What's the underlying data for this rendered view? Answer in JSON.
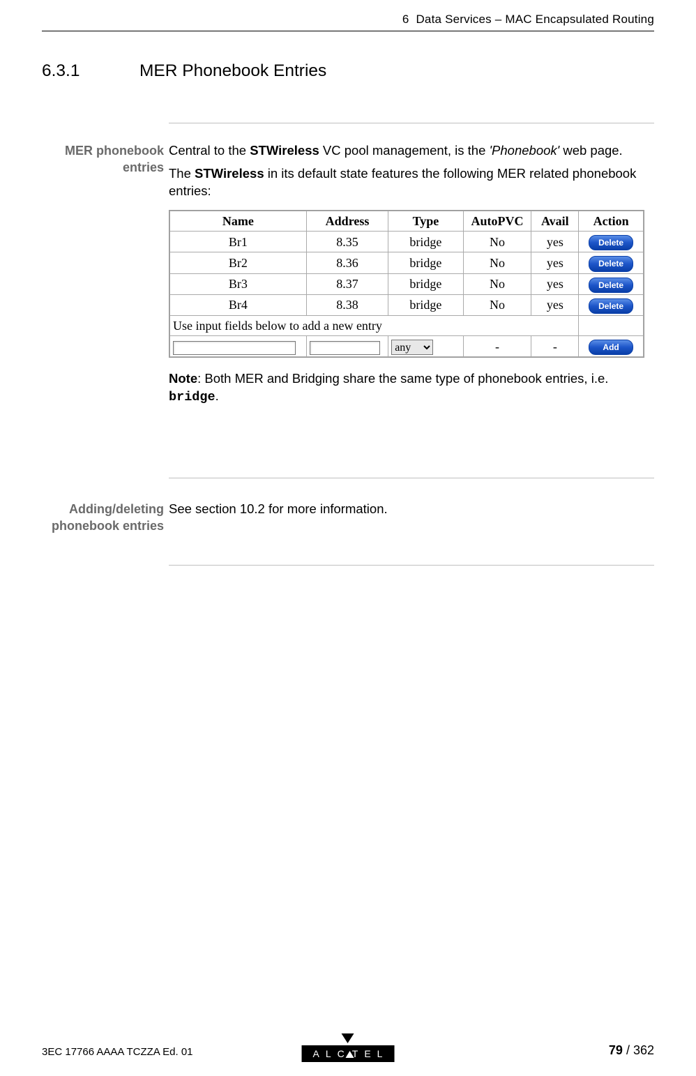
{
  "header": {
    "chapter_ref": "6",
    "chapter_title": "Data Services – MAC Encapsulated Routing"
  },
  "section": {
    "number": "6.3.1",
    "title": "MER Phonebook Entries"
  },
  "blocks": {
    "mer_entries": {
      "side_label_line1": "MER phonebook",
      "side_label_line2": "entries",
      "p1_pre": "Central to the ",
      "p1_bold": "STWireless",
      "p1_mid": " VC pool management, is the ",
      "p1_ital": "'Phonebook'",
      "p1_post": " web page.",
      "p2_pre": "The ",
      "p2_bold": "STWireless",
      "p2_post": " in its default state features the following MER related phonebook entries:",
      "note_bold": "Note",
      "note_pre": ": Both MER and Bridging share the same type of phonebook entries, i.e. ",
      "note_code": "bridge",
      "note_post": "."
    },
    "adding": {
      "side_label_line1": "Adding/deleting",
      "side_label_line2": "phonebook entries",
      "text": "See section 10.2 for more information."
    }
  },
  "table": {
    "headers": {
      "name": "Name",
      "address": "Address",
      "type": "Type",
      "autopvc": "AutoPVC",
      "avail": "Avail",
      "action": "Action"
    },
    "rows": [
      {
        "name": "Br1",
        "address": "8.35",
        "type": "bridge",
        "autopvc": "No",
        "avail": "yes",
        "action": "Delete"
      },
      {
        "name": "Br2",
        "address": "8.36",
        "type": "bridge",
        "autopvc": "No",
        "avail": "yes",
        "action": "Delete"
      },
      {
        "name": "Br3",
        "address": "8.37",
        "type": "bridge",
        "autopvc": "No",
        "avail": "yes",
        "action": "Delete"
      },
      {
        "name": "Br4",
        "address": "8.38",
        "type": "bridge",
        "autopvc": "No",
        "avail": "yes",
        "action": "Delete"
      }
    ],
    "hint_row": "Use input fields below to add a new entry",
    "input_row": {
      "type_selected": "any",
      "autopvc": "-",
      "avail": "-",
      "action": "Add"
    }
  },
  "footer": {
    "doc_id": "3EC 17766 AAAA TCZZA Ed. 01",
    "page_current": "79",
    "page_sep": " / ",
    "page_total": "362",
    "logo_left": "ALC",
    "logo_right": "TEL"
  }
}
